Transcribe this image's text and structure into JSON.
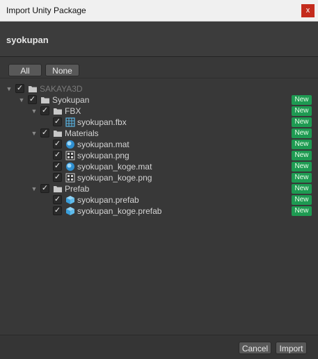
{
  "window": {
    "title": "Import Unity Package",
    "close_glyph": "x"
  },
  "package_name": "syokupan",
  "toolbar": {
    "all_label": "All",
    "none_label": "None"
  },
  "tree": [
    {
      "label": "SAKAYA3D",
      "icon": "folder-icon",
      "depth": 0,
      "expanded": true,
      "checked": true,
      "is_new": false,
      "dim": true
    },
    {
      "label": "Syokupan",
      "icon": "folder-icon",
      "depth": 1,
      "expanded": true,
      "checked": true,
      "is_new": true,
      "dim": false
    },
    {
      "label": "FBX",
      "icon": "folder-icon",
      "depth": 2,
      "expanded": true,
      "checked": true,
      "is_new": true,
      "dim": false
    },
    {
      "label": "syokupan.fbx",
      "icon": "mesh-icon",
      "depth": 3,
      "expanded": null,
      "checked": true,
      "is_new": true,
      "dim": false
    },
    {
      "label": "Materials",
      "icon": "folder-icon",
      "depth": 2,
      "expanded": true,
      "checked": true,
      "is_new": true,
      "dim": false
    },
    {
      "label": "syokupan.mat",
      "icon": "material-icon",
      "depth": 3,
      "expanded": null,
      "checked": true,
      "is_new": true,
      "dim": false
    },
    {
      "label": "syokupan.png",
      "icon": "texture-icon",
      "depth": 3,
      "expanded": null,
      "checked": true,
      "is_new": true,
      "dim": false
    },
    {
      "label": "syokupan_koge.mat",
      "icon": "material-icon",
      "depth": 3,
      "expanded": null,
      "checked": true,
      "is_new": true,
      "dim": false
    },
    {
      "label": "syokupan_koge.png",
      "icon": "texture-icon",
      "depth": 3,
      "expanded": null,
      "checked": true,
      "is_new": true,
      "dim": false
    },
    {
      "label": "Prefab",
      "icon": "folder-icon",
      "depth": 2,
      "expanded": true,
      "checked": true,
      "is_new": true,
      "dim": false
    },
    {
      "label": "syokupan.prefab",
      "icon": "prefab-icon",
      "depth": 3,
      "expanded": null,
      "checked": true,
      "is_new": true,
      "dim": false
    },
    {
      "label": "syokupan_koge.prefab",
      "icon": "prefab-icon",
      "depth": 3,
      "expanded": null,
      "checked": true,
      "is_new": true,
      "dim": false
    }
  ],
  "new_badge_label": "New",
  "footer": {
    "cancel_label": "Cancel",
    "import_label": "Import"
  },
  "colors": {
    "new_badge": "#1e9a52",
    "close_button": "#c42b1c",
    "background": "#383838"
  }
}
